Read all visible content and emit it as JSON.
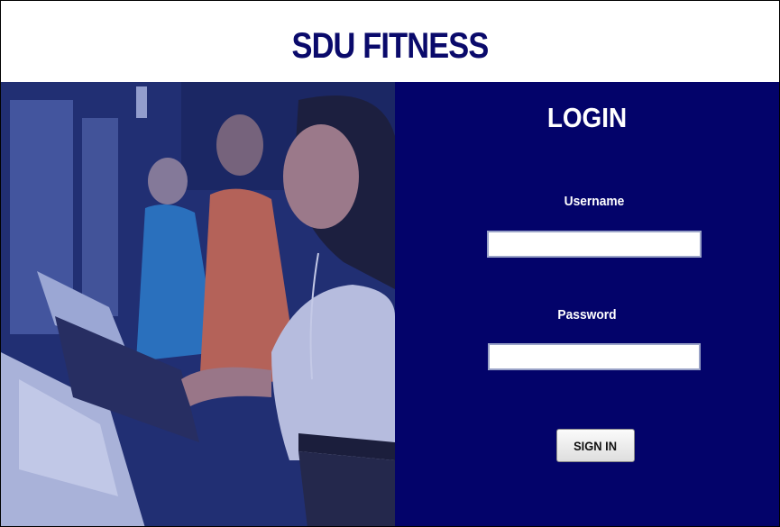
{
  "header": {
    "title": "SDU FITNESS"
  },
  "login": {
    "title": "LOGIN",
    "username_label": "Username",
    "username_value": "",
    "password_label": "Password",
    "password_value": "",
    "signin_label": "SIGN IN"
  },
  "colors": {
    "brand_navy": "#03036a",
    "title_text": "#0a0a6b",
    "panel_text": "#ffffff"
  }
}
